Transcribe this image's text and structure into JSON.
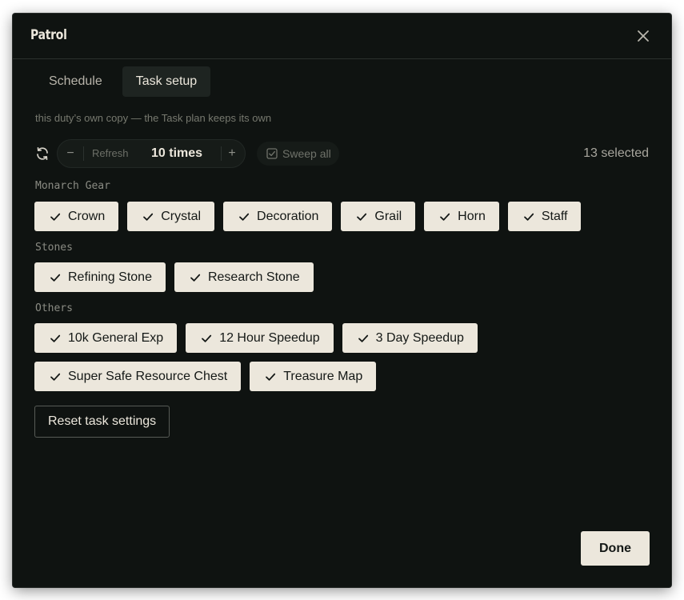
{
  "dialog": {
    "title": "Patrol"
  },
  "tabs": [
    {
      "label": "Schedule",
      "active": false
    },
    {
      "label": "Task setup",
      "active": true
    }
  ],
  "hint": "this duty’s own copy — the Task plan keeps its own",
  "controls": {
    "refresh_label": "Refresh",
    "times_value": "10 times",
    "minus_symbol": "−",
    "plus_symbol": "+",
    "sweep_label": "Sweep all",
    "selected_count": "13 selected"
  },
  "groups": [
    {
      "label": "Monarch Gear",
      "items": [
        {
          "label": "Crown",
          "checked": true
        },
        {
          "label": "Crystal",
          "checked": true
        },
        {
          "label": "Decoration",
          "checked": true
        },
        {
          "label": "Grail",
          "checked": true
        },
        {
          "label": "Horn",
          "checked": true
        },
        {
          "label": "Staff",
          "checked": true
        }
      ]
    },
    {
      "label": "Stones",
      "items": [
        {
          "label": "Refining Stone",
          "checked": true
        },
        {
          "label": "Research Stone",
          "checked": true
        }
      ]
    },
    {
      "label": "Others",
      "items": [
        {
          "label": "10k General Exp",
          "checked": true
        },
        {
          "label": "12 Hour Speedup",
          "checked": true
        },
        {
          "label": "3 Day Speedup",
          "checked": true
        },
        {
          "label": "Super Safe Resource Chest",
          "checked": true
        },
        {
          "label": "Treasure Map",
          "checked": true
        }
      ]
    }
  ],
  "footer": {
    "reset_label": "Reset task settings",
    "done_label": "Done"
  },
  "colors": {
    "background": "#0f1311",
    "chip": "#ece7dc",
    "text": "#ece7dc",
    "muted": "#77796f"
  },
  "icons": {
    "close": "close-icon",
    "refresh": "refresh-icon",
    "sweep": "checkbox-icon",
    "check": "check-icon"
  }
}
